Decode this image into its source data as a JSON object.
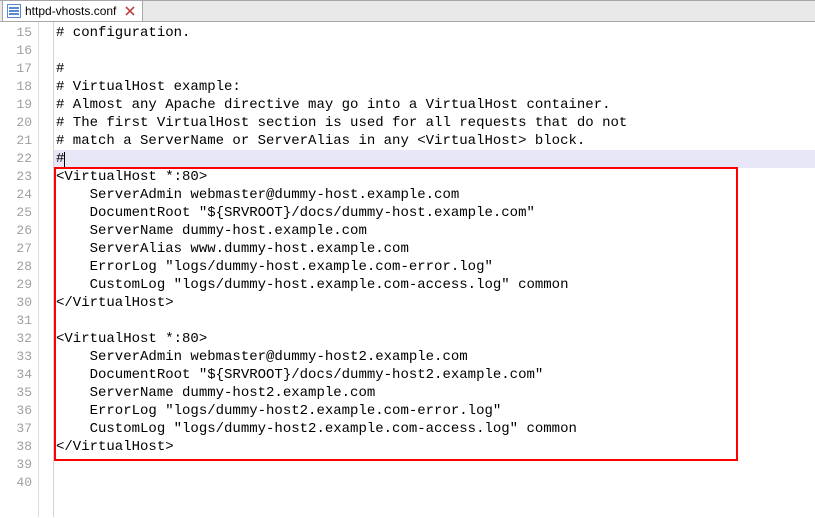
{
  "tab": {
    "filename": "httpd-vhosts.conf"
  },
  "icons": {
    "file": "file-icon",
    "close": "close-icon"
  },
  "first_line_no": 15,
  "current_line_index": 7,
  "highlight_box": {
    "from_idx": 8,
    "to_idx": 23
  },
  "lines": [
    "# configuration.",
    "",
    "#",
    "# VirtualHost example:",
    "# Almost any Apache directive may go into a VirtualHost container.",
    "# The first VirtualHost section is used for all requests that do not",
    "# match a ServerName or ServerAlias in any <VirtualHost> block.",
    "#",
    "<VirtualHost *:80>",
    "    ServerAdmin webmaster@dummy-host.example.com",
    "    DocumentRoot \"${SRVROOT}/docs/dummy-host.example.com\"",
    "    ServerName dummy-host.example.com",
    "    ServerAlias www.dummy-host.example.com",
    "    ErrorLog \"logs/dummy-host.example.com-error.log\"",
    "    CustomLog \"logs/dummy-host.example.com-access.log\" common",
    "</VirtualHost>",
    "",
    "<VirtualHost *:80>",
    "    ServerAdmin webmaster@dummy-host2.example.com",
    "    DocumentRoot \"${SRVROOT}/docs/dummy-host2.example.com\"",
    "    ServerName dummy-host2.example.com",
    "    ErrorLog \"logs/dummy-host2.example.com-error.log\"",
    "    CustomLog \"logs/dummy-host2.example.com-access.log\" common",
    "</VirtualHost>",
    "",
    ""
  ]
}
